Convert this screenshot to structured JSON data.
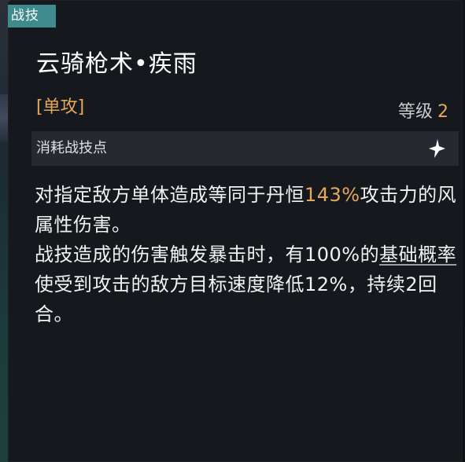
{
  "tag": {
    "label": "战技"
  },
  "skill": {
    "name": "云骑枪术•疾雨",
    "target_type": "[单攻]",
    "level_label": "等级",
    "level_value": "2",
    "cost_label": "消耗战技点"
  },
  "description": {
    "p1_a": "对指定敌方单体造成等同于丹恒",
    "p1_highlight": "143%",
    "p1_b": "攻击力的风属性伤害。",
    "p2_a": "战技造成的伤害触发暴击时，有100%的",
    "p2_keyword": "基础概率",
    "p2_b": "使受到攻击的敌方目标速度降低12%，持续2回合。"
  },
  "colors": {
    "accent": "#e5a85b",
    "tag_bg": "#3f8a8c",
    "panel_bg": "#15181c",
    "cost_row_bg": "#262a30"
  },
  "icons": {
    "skill_point": "four-point-star-icon"
  }
}
